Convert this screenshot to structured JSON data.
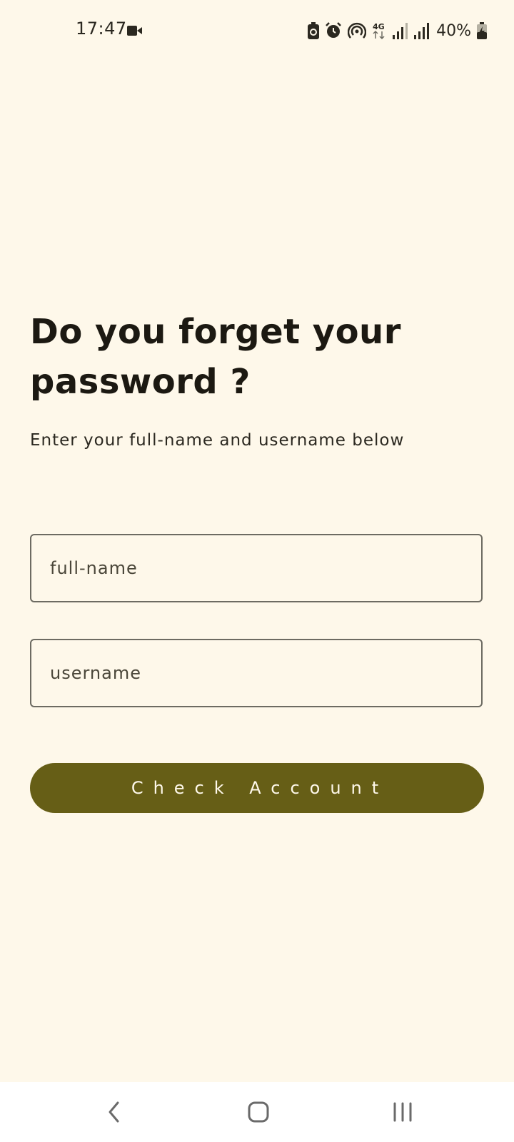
{
  "status_bar": {
    "time": "17:47",
    "battery_percent": "40%",
    "network_label": "4G",
    "icons": [
      "video-icon",
      "battery-saver-icon",
      "alarm-icon",
      "hotspot-icon",
      "4g-data-icon",
      "signal-icon",
      "signal-icon",
      "battery-charging-icon"
    ]
  },
  "main": {
    "title": "Do you forget your password ?",
    "subtitle": "Enter your full-name and username below",
    "fullname_field": {
      "placeholder": "full-name",
      "value": ""
    },
    "username_field": {
      "placeholder": "username",
      "value": ""
    },
    "check_button_label": "Check Account"
  },
  "nav_bar": {
    "icons": [
      "back-icon",
      "home-icon",
      "recents-icon"
    ]
  },
  "colors": {
    "background": "#fef8ea",
    "button": "#665e16",
    "button_text": "#fef8ea",
    "text": "#1c1912",
    "field_border": "#6d6b62"
  }
}
